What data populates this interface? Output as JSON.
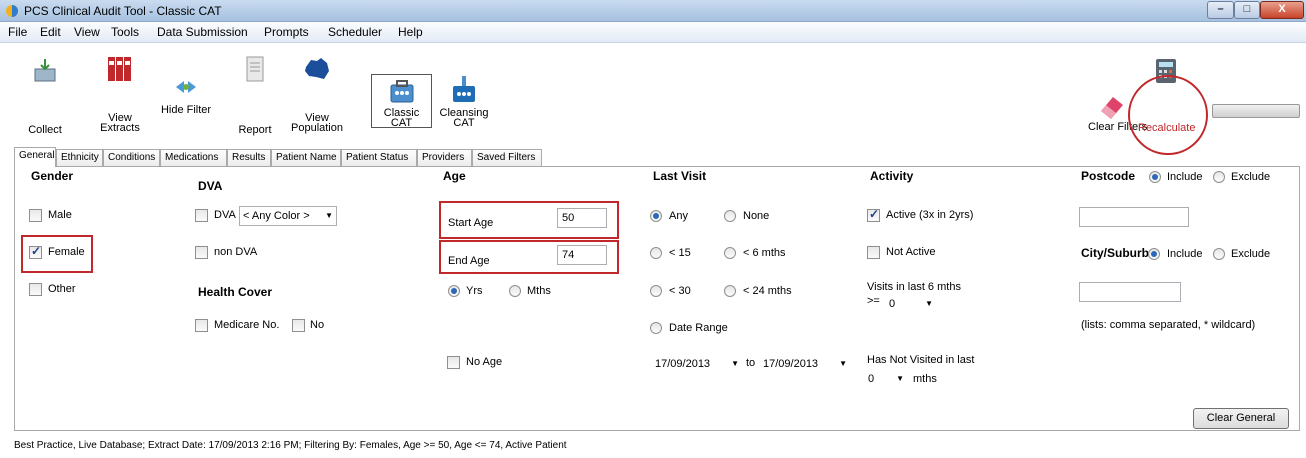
{
  "window": {
    "title": "PCS Clinical Audit Tool - Classic CAT",
    "min": "–",
    "max": "□",
    "close": "X"
  },
  "menu": [
    "File",
    "Edit",
    "View",
    "Tools",
    "Data Submission",
    "Prompts",
    "Scheduler",
    "Help"
  ],
  "toolbar": {
    "collect": "Collect",
    "view_extracts": [
      "View",
      "Extracts"
    ],
    "hide_filter": "Hide Filter",
    "report": "Report",
    "view_population": [
      "View",
      "Population"
    ],
    "classic_cat": [
      "Classic",
      "CAT"
    ],
    "cleansing_cat": [
      "Cleansing",
      "CAT"
    ],
    "clear_filters": "Clear Filters",
    "recalculate": "Recalculate"
  },
  "tabs": [
    "General",
    "Ethnicity",
    "Conditions",
    "Medications",
    "Results",
    "Patient Name",
    "Patient Status",
    "Providers",
    "Saved Filters"
  ],
  "general": {
    "gender": {
      "header": "Gender",
      "male": "Male",
      "female": "Female",
      "other": "Other"
    },
    "dva": {
      "header": "DVA",
      "dva": "DVA",
      "color_select": "< Any Color >",
      "non_dva": "non DVA"
    },
    "health_cover": {
      "header": "Health Cover",
      "medicare": "Medicare No.",
      "no": "No"
    },
    "age": {
      "header": "Age",
      "start_label": "Start Age",
      "start_value": "50",
      "end_label": "End Age",
      "end_value": "74",
      "yrs": "Yrs",
      "mths": "Mths",
      "no_age": "No Age"
    },
    "last_visit": {
      "header": "Last Visit",
      "any": "Any",
      "none": "None",
      "lt15": "< 15",
      "lt6m": "< 6 mths",
      "lt30": "< 30",
      "lt24m": "< 24 mths",
      "date_range": "Date Range",
      "from": "17/09/2013",
      "to_label": "to",
      "to": "17/09/2013"
    },
    "activity": {
      "header": "Activity",
      "active": "Active (3x in 2yrs)",
      "not_active": "Not Active",
      "visits_label": "Visits in last 6 mths",
      "gte": ">=",
      "visits_value": "0",
      "not_visited": "Has Not Visited in last",
      "not_visited_value": "0",
      "mths": "mths"
    },
    "postcode": {
      "header": "Postcode",
      "include": "Include",
      "exclude": "Exclude",
      "value": ""
    },
    "city": {
      "header": "City/Suburb",
      "include": "Include",
      "exclude": "Exclude",
      "value": "",
      "hint": "(lists: comma separated, * wildcard)"
    },
    "clear_general": "Clear General"
  },
  "status": "Best Practice, Live Database; Extract Date: 17/09/2013 2:16 PM; Filtering By: Females, Age >= 50, Age <= 74, Active Patient"
}
